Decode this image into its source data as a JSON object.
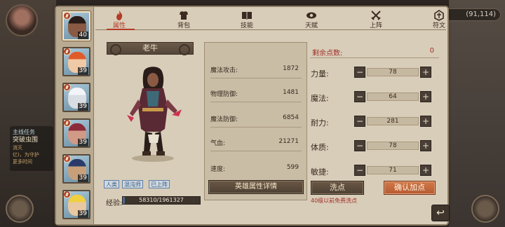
{
  "background": {
    "quest_title": "主线任务",
    "quest_name": "突破虫围",
    "quest_line2": "消灭",
    "quest_line3": "亿)，为守护",
    "quest_line4": "更多时间",
    "currency_text": "(91,114)"
  },
  "tabs": [
    {
      "label": "属性",
      "icon": "fire-icon",
      "active": true
    },
    {
      "label": "背包",
      "icon": "armor-icon",
      "active": false
    },
    {
      "label": "技能",
      "icon": "book-icon",
      "active": false
    },
    {
      "label": "天赋",
      "icon": "eye-icon",
      "active": false
    },
    {
      "label": "上阵",
      "icon": "swords-icon",
      "active": false
    },
    {
      "label": "符文",
      "icon": "rune-icon",
      "active": false
    }
  ],
  "hero_list": [
    {
      "level": "40",
      "selected": true,
      "skin": "#8a5a44",
      "hair": "#2a1c18"
    },
    {
      "level": "39",
      "selected": false,
      "skin": "#f0c9a6",
      "hair": "#e05a2a"
    },
    {
      "level": "39",
      "selected": false,
      "skin": "#d8dde4",
      "hair": "#f2f4f8"
    },
    {
      "level": "39",
      "selected": false,
      "skin": "#d09a86",
      "hair": "#8a2a3a"
    },
    {
      "level": "39",
      "selected": false,
      "skin": "#c7a07a",
      "hair": "#2a3a6a"
    },
    {
      "level": "39",
      "selected": false,
      "skin": "#e8c8a0",
      "hair": "#f0d040"
    }
  ],
  "hero": {
    "name": "老牛",
    "tags": [
      "人类",
      "混沌师",
      "已上阵"
    ],
    "exp_label": "经验:",
    "exp_text": "58310/1961327",
    "exp_fraction": 0.03
  },
  "stats": [
    {
      "label": "魔法攻击:",
      "value": "1872"
    },
    {
      "label": "物理防御:",
      "value": "1481"
    },
    {
      "label": "魔法防御:",
      "value": "6854"
    },
    {
      "label": "气血:",
      "value": "21271"
    },
    {
      "label": "速度:",
      "value": "599"
    }
  ],
  "detail_button": "英雄属性详情",
  "points": {
    "remaining_label": "剩余点数:",
    "remaining_value": "0",
    "attributes": [
      {
        "label": "力量:",
        "value": "78"
      },
      {
        "label": "魔法:",
        "value": "64"
      },
      {
        "label": "耐力:",
        "value": "281"
      },
      {
        "label": "体质:",
        "value": "78"
      },
      {
        "label": "敏捷:",
        "value": "71"
      }
    ],
    "minus": "−",
    "plus": "+",
    "reset_button": "洗点",
    "confirm_button": "确认加点",
    "reset_note": "40级以前免费洗点"
  },
  "back_icon": "↩",
  "colors": {
    "accent_red": "#b23a26",
    "confirm_orange": "#c8683c",
    "paper": "#d8cdb9",
    "tag_blue": "#3c5e86"
  }
}
